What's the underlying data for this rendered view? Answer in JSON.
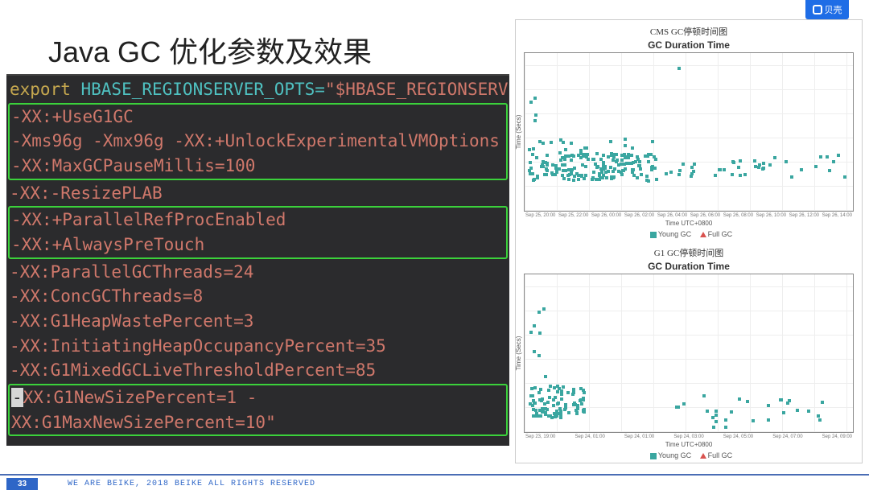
{
  "slide": {
    "title": "Java GC 优化参数及效果",
    "logo_text": "贝壳",
    "page_number": "33",
    "footer": "WE ARE BEIKE, 2018 BEIKE ALL RIGHTS RESERVED"
  },
  "terminal": {
    "export_kw": "export",
    "export_var": " HBASE_REGIONSERVER_OPTS=",
    "export_val": "\"$HBASE_REGIONSERVER_OP",
    "box1": [
      "-XX:+UseG1GC",
      "-Xms96g -Xmx96g -XX:+UnlockExperimentalVMOptions",
      "-XX:MaxGCPauseMillis=100"
    ],
    "line_resize": "-XX:-ResizePLAB",
    "box2": [
      "-XX:+ParallelRefProcEnabled",
      "-XX:+AlwaysPreTouch"
    ],
    "line_pgt": "-XX:ParallelGCThreads=24",
    "line_cgt": "-XX:ConcGCThreads=8",
    "line_hwp": "-XX:G1HeapWastePercent=3",
    "line_ihop": "-XX:InitiatingHeapOccupancyPercent=35",
    "line_mglt": "-XX:G1MixedGCLiveThresholdPercent=85",
    "box3_a": "-",
    "box3_b": "XX:G1NewSizePercent=1  -XX:G1MaxNewSizePercent=10\""
  },
  "charts": {
    "top": {
      "cn_title": "CMS GC停顿时间图",
      "en_title": "GC Duration Time",
      "ylabel": "Time (Secs)",
      "xlabel": "Time UTC+0800",
      "xticks": [
        "Sep 25, 20:00",
        "Sep 25, 22:00",
        "Sep 26, 00:00",
        "Sep 26, 02:00",
        "Sep 26, 04:00",
        "Sep 26, 06:00",
        "Sep 26, 08:00",
        "Sep 26, 10:00",
        "Sep 26, 12:00",
        "Sep 26, 14:00"
      ],
      "legend_a": "Young GC",
      "legend_b": "Full GC"
    },
    "bottom": {
      "cn_title": "G1 GC停顿时间图",
      "en_title": "GC Duration Time",
      "ylabel": "Time (Secs)",
      "xlabel": "Time UTC+0800",
      "xticks": [
        "Sep 23, 19:00",
        "Sep 24, 01:00",
        "Sep 24, 01:00",
        "Sep 24, 03:00",
        "Sep 24, 05:00",
        "Sep 24, 07:00",
        "Sep 24, 09:00"
      ],
      "legend_a": "Young GC",
      "legend_b": "Full GC"
    }
  },
  "chart_data": [
    {
      "type": "scatter",
      "title": "CMS GC停顿时间图 — GC Duration Time",
      "xlabel": "Time UTC+0800",
      "ylabel": "Time (Secs)",
      "ylim": [
        0,
        0.4
      ],
      "series": [
        {
          "name": "Young GC",
          "note": "dense band ≈0.08–0.12 across Sep 25 20:00–Sep 26 00:00, sparse same band afterward; outlier ≈0.35 near Sep 26 02:00; burst ≈0.28 at Sep 25 20:00"
        },
        {
          "name": "Full GC",
          "note": "no visible points"
        }
      ]
    },
    {
      "type": "scatter",
      "title": "G1 GC停顿时间图 — GC Duration Time",
      "xlabel": "Time UTC+0800",
      "ylabel": "Time (Secs)",
      "ylim": [
        0,
        0.25
      ],
      "series": [
        {
          "name": "Young GC",
          "note": "dense cluster ≈0.03–0.07 at Sep 23 19:00–23:00; sparse ≈0.02–0.05 after Sep 24 03:00; startup burst up to ≈0.20"
        },
        {
          "name": "Full GC",
          "note": "no visible points"
        }
      ]
    }
  ]
}
